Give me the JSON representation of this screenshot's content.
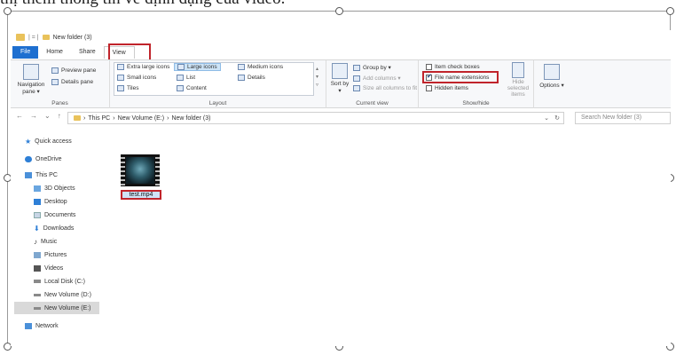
{
  "caption": "thị thêm thông tin về định dạng của video.",
  "window": {
    "title": "New folder (3)",
    "title_prefix": "| = |"
  },
  "tabs": [
    "File",
    "Home",
    "Share",
    "View"
  ],
  "ribbon": {
    "panes": {
      "navigation_pane": "Navigation pane ▾",
      "preview_pane": "Preview pane",
      "details_pane": "Details pane",
      "label": "Panes"
    },
    "layout": {
      "extra_large": "Extra large icons",
      "large": "Large icons",
      "medium": "Medium icons",
      "small": "Small icons",
      "list": "List",
      "details": "Details",
      "tiles": "Tiles",
      "content": "Content",
      "label": "Layout"
    },
    "current_view": {
      "sort_by": "Sort by ▾",
      "group_by": "Group by ▾",
      "add_columns": "Add columns ▾",
      "size_all": "Size all columns to fit",
      "label": "Current view"
    },
    "show_hide": {
      "item_check_boxes": "Item check boxes",
      "file_name_extensions": "File name extensions",
      "hidden_items": "Hidden items",
      "hide_selected": "Hide selected items",
      "label": "Show/hide"
    },
    "options": "Options ▾"
  },
  "address": {
    "path": [
      "This PC",
      "New Volume (E:)",
      "New folder (3)"
    ],
    "search_placeholder": "Search New folder (3)"
  },
  "sidebar": {
    "items": [
      {
        "label": "Quick access",
        "icon": "star-icon"
      },
      {
        "label": "OneDrive",
        "icon": "cloud-icon"
      },
      {
        "label": "This PC",
        "icon": "computer-icon"
      },
      {
        "label": "3D Objects",
        "icon": "cube-icon"
      },
      {
        "label": "Desktop",
        "icon": "desktop-icon"
      },
      {
        "label": "Documents",
        "icon": "document-icon"
      },
      {
        "label": "Downloads",
        "icon": "download-icon"
      },
      {
        "label": "Music",
        "icon": "music-icon"
      },
      {
        "label": "Pictures",
        "icon": "pictures-icon"
      },
      {
        "label": "Videos",
        "icon": "video-icon"
      },
      {
        "label": "Local Disk (C:)",
        "icon": "drive-icon"
      },
      {
        "label": "New Volume (D:)",
        "icon": "drive-icon"
      },
      {
        "label": "New Volume (E:)",
        "icon": "drive-icon"
      },
      {
        "label": "Network",
        "icon": "network-icon"
      }
    ]
  },
  "files": [
    {
      "name": "test.mp4",
      "icon": "video-thumbnail-icon"
    }
  ],
  "colors": {
    "accent": "#1e6fd0",
    "highlight": "#c0242b",
    "folder": "#e9c25b"
  }
}
